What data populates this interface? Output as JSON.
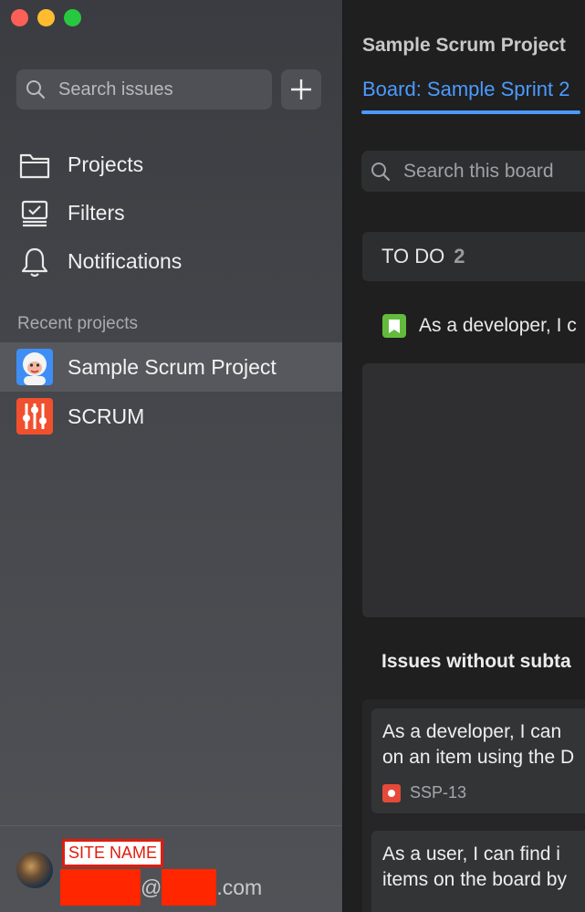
{
  "sidebar": {
    "search_placeholder": "Search issues",
    "nav": [
      {
        "label": "Projects",
        "icon": "folder-icon"
      },
      {
        "label": "Filters",
        "icon": "filters-icon"
      },
      {
        "label": "Notifications",
        "icon": "bell-icon"
      }
    ],
    "recent_title": "Recent projects",
    "recent": [
      {
        "label": "Sample Scrum Project",
        "icon": "yeti-avatar-icon",
        "active": true
      },
      {
        "label": "SCRUM",
        "icon": "sliders-avatar-icon",
        "active": false
      }
    ],
    "footer": {
      "site_name": "SITE NAME",
      "email_at": "@",
      "email_suffix": ".com"
    }
  },
  "main": {
    "project_title": "Sample Scrum Project",
    "board_tab": "Board: Sample Sprint 2",
    "board_search_placeholder": "Search this board",
    "column": {
      "name": "TO DO",
      "count": "2"
    },
    "story_title": "As a developer, I c",
    "section_title": "Issues without subta",
    "cards": [
      {
        "line1": "As a developer, I can",
        "line2": "on an item using the D",
        "key": "SSP-13"
      },
      {
        "line1": "As a user, I can find i",
        "line2": "items on the board by"
      }
    ]
  },
  "colors": {
    "accent": "#4c9aff",
    "story": "#63ba3c",
    "bug": "#e5493a",
    "redaction": "#ff2600"
  }
}
